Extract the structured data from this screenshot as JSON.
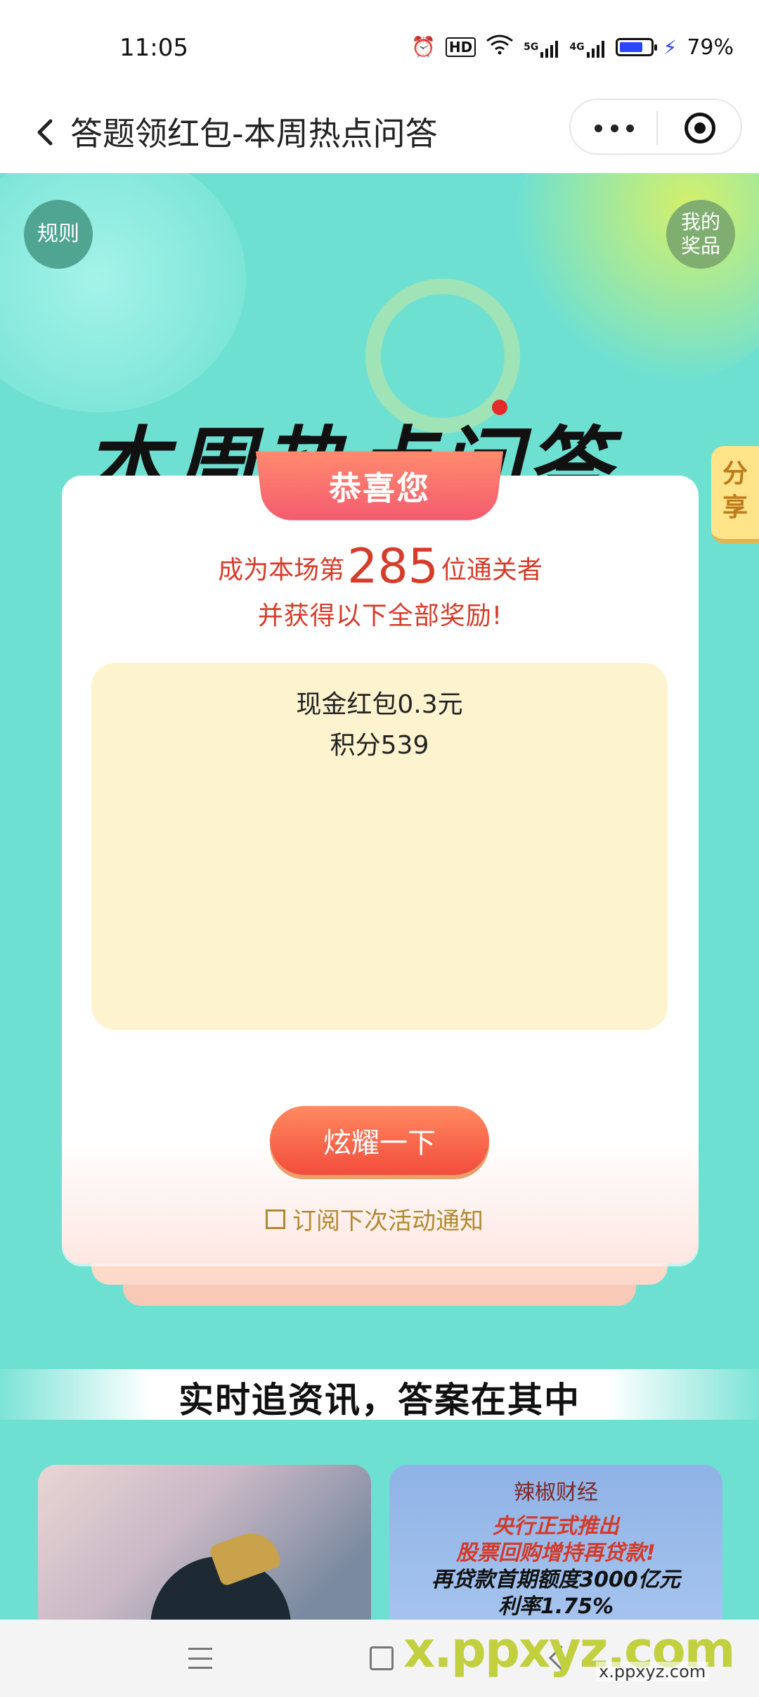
{
  "status_bar": {
    "time": "11:05",
    "alarm_icon": "⏰",
    "hd_icon": "HD",
    "wifi_icon": "wifi",
    "signal1": "5G",
    "signal2": "4G",
    "battery": "79%",
    "battery_level": 0.79
  },
  "nav": {
    "title": "答题领红包-本周热点问答"
  },
  "page": {
    "rules": "规则",
    "my_prizes": "我的奖品",
    "share": "分享",
    "headline": "本周热点问答",
    "congrats": "恭喜您",
    "line1_prefix": "成为本场第",
    "rank": "285",
    "line1_suffix": "位通关者",
    "line2": "并获得以下全部奖励!",
    "rewards": [
      "现金红包0.3元",
      "积分539"
    ],
    "boast_button": "炫耀一下",
    "subscribe_label": "订阅下次活动通知",
    "section_banner": "实时追资讯，答案在其中"
  },
  "news": {
    "right_brand": "辣椒财经",
    "right_lines": [
      "央行正式推出",
      "股票回购增持再贷款!",
      "再贷款首期额度3000亿元",
      "利率1.75%"
    ]
  },
  "watermark": {
    "main": "x.ppxyz.com",
    "sub": "x.ppxyz.com"
  },
  "colors": {
    "background": "#6ee0d2",
    "accent_red": "#d63c2a",
    "button_orange": "#f24c3c",
    "reward_bg": "#fdf4cf"
  }
}
